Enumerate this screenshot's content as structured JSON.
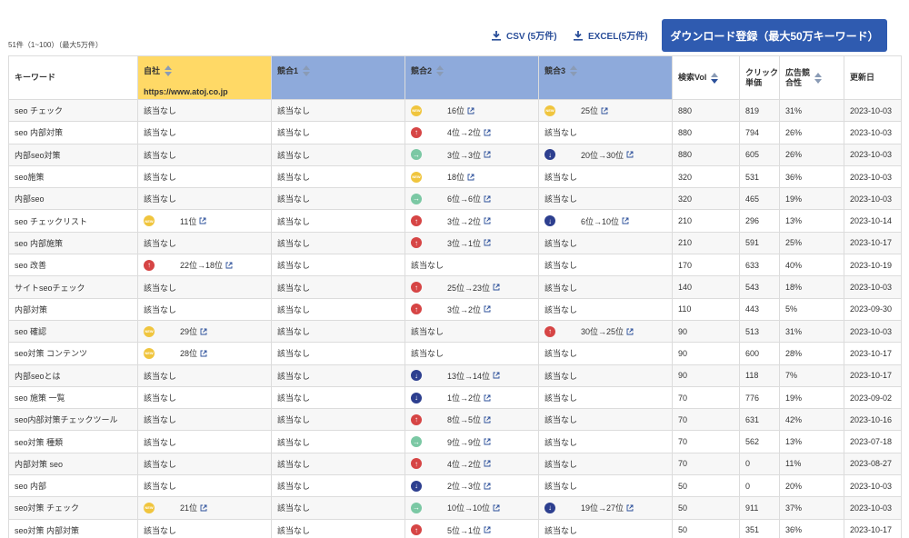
{
  "toolbar": {
    "count_text": "51件（1~100）（最大5万件）",
    "csv_label": "CSV (5万件)",
    "excel_label": "EXCEL(5万件)",
    "register_label": "ダウンロード登録（最大50万キーワード）"
  },
  "headers": {
    "keyword": "キーワード",
    "self": "自社",
    "self_url": "https://www.atoj.co.jp",
    "comp1": "競合1",
    "comp2": "競合2",
    "comp3": "競合3",
    "volume": "検索Vol",
    "cpc_line1": "クリック",
    "cpc_line2": "単価",
    "competition_line1": "広告競",
    "competition_line2": "合性",
    "updated": "更新日"
  },
  "colors": {
    "self_header": "#ffd966",
    "comp_header": "#8eaadb",
    "button": "#2f5bb0",
    "up": "#d64545",
    "down": "#2d3f8f",
    "same": "#7bc8a4",
    "new": "#f0c53e"
  },
  "none_text": "該当なし",
  "rows": [
    {
      "kw": "seo チェック",
      "self": null,
      "c1": null,
      "c2": {
        "icon": "new",
        "text": "16位"
      },
      "c3": {
        "icon": "new",
        "text": "25位"
      },
      "vol": "880",
      "cpc": "819",
      "comp": "31%",
      "date": "2023-10-03"
    },
    {
      "kw": "seo 内部対策",
      "self": null,
      "c1": null,
      "c2": {
        "icon": "up",
        "text": "4位→2位"
      },
      "c3": null,
      "vol": "880",
      "cpc": "794",
      "comp": "26%",
      "date": "2023-10-03"
    },
    {
      "kw": "内部seo対策",
      "self": null,
      "c1": null,
      "c2": {
        "icon": "same",
        "text": "3位→3位"
      },
      "c3": {
        "icon": "down",
        "text": "20位→30位"
      },
      "vol": "880",
      "cpc": "605",
      "comp": "26%",
      "date": "2023-10-03"
    },
    {
      "kw": "seo施策",
      "self": null,
      "c1": null,
      "c2": {
        "icon": "new",
        "text": "18位"
      },
      "c3": null,
      "vol": "320",
      "cpc": "531",
      "comp": "36%",
      "date": "2023-10-03"
    },
    {
      "kw": "内部seo",
      "self": null,
      "c1": null,
      "c2": {
        "icon": "same",
        "text": "6位→6位"
      },
      "c3": null,
      "vol": "320",
      "cpc": "465",
      "comp": "19%",
      "date": "2023-10-03"
    },
    {
      "kw": "seo チェックリスト",
      "self": {
        "icon": "new",
        "text": "11位"
      },
      "c1": null,
      "c2": {
        "icon": "up",
        "text": "3位→2位"
      },
      "c3": {
        "icon": "down",
        "text": "6位→10位"
      },
      "vol": "210",
      "cpc": "296",
      "comp": "13%",
      "date": "2023-10-14"
    },
    {
      "kw": "seo 内部施策",
      "self": null,
      "c1": null,
      "c2": {
        "icon": "up",
        "text": "3位→1位"
      },
      "c3": null,
      "vol": "210",
      "cpc": "591",
      "comp": "25%",
      "date": "2023-10-17"
    },
    {
      "kw": "seo 改善",
      "self": {
        "icon": "up",
        "text": "22位→18位"
      },
      "c1": null,
      "c2": null,
      "c3": null,
      "vol": "170",
      "cpc": "633",
      "comp": "40%",
      "date": "2023-10-19"
    },
    {
      "kw": "サイトseoチェック",
      "self": null,
      "c1": null,
      "c2": {
        "icon": "up",
        "text": "25位→23位"
      },
      "c3": null,
      "vol": "140",
      "cpc": "543",
      "comp": "18%",
      "date": "2023-10-03"
    },
    {
      "kw": "内部対策",
      "self": null,
      "c1": null,
      "c2": {
        "icon": "up",
        "text": "3位→2位"
      },
      "c3": null,
      "vol": "110",
      "cpc": "443",
      "comp": "5%",
      "date": "2023-09-30"
    },
    {
      "kw": "seo 確認",
      "self": {
        "icon": "new",
        "text": "29位"
      },
      "c1": null,
      "c2": null,
      "c3": {
        "icon": "up",
        "text": "30位→25位"
      },
      "vol": "90",
      "cpc": "513",
      "comp": "31%",
      "date": "2023-10-03"
    },
    {
      "kw": "seo対策 コンテンツ",
      "self": {
        "icon": "new",
        "text": "28位"
      },
      "c1": null,
      "c2": null,
      "c3": null,
      "vol": "90",
      "cpc": "600",
      "comp": "28%",
      "date": "2023-10-17"
    },
    {
      "kw": "内部seoとは",
      "self": null,
      "c1": null,
      "c2": {
        "icon": "down",
        "text": "13位→14位"
      },
      "c3": null,
      "vol": "90",
      "cpc": "118",
      "comp": "7%",
      "date": "2023-10-17"
    },
    {
      "kw": "seo 施策 一覧",
      "self": null,
      "c1": null,
      "c2": {
        "icon": "down",
        "text": "1位→2位"
      },
      "c3": null,
      "vol": "70",
      "cpc": "776",
      "comp": "19%",
      "date": "2023-09-02"
    },
    {
      "kw": "seo内部対策チェックツール",
      "self": null,
      "c1": null,
      "c2": {
        "icon": "up",
        "text": "8位→5位"
      },
      "c3": null,
      "vol": "70",
      "cpc": "631",
      "comp": "42%",
      "date": "2023-10-16"
    },
    {
      "kw": "seo対策 種類",
      "self": null,
      "c1": null,
      "c2": {
        "icon": "same",
        "text": "9位→9位"
      },
      "c3": null,
      "vol": "70",
      "cpc": "562",
      "comp": "13%",
      "date": "2023-07-18"
    },
    {
      "kw": "内部対策 seo",
      "self": null,
      "c1": null,
      "c2": {
        "icon": "up",
        "text": "4位→2位"
      },
      "c3": null,
      "vol": "70",
      "cpc": "0",
      "comp": "11%",
      "date": "2023-08-27"
    },
    {
      "kw": "seo 内部",
      "self": null,
      "c1": null,
      "c2": {
        "icon": "down",
        "text": "2位→3位"
      },
      "c3": null,
      "vol": "50",
      "cpc": "0",
      "comp": "20%",
      "date": "2023-10-03"
    },
    {
      "kw": "seo対策 チェック",
      "self": {
        "icon": "new",
        "text": "21位"
      },
      "c1": null,
      "c2": {
        "icon": "same",
        "text": "10位→10位"
      },
      "c3": {
        "icon": "down",
        "text": "19位→27位"
      },
      "vol": "50",
      "cpc": "911",
      "comp": "37%",
      "date": "2023-10-03"
    },
    {
      "kw": "seo対策 内部対策",
      "self": null,
      "c1": null,
      "c2": {
        "icon": "up",
        "text": "5位→1位"
      },
      "c3": null,
      "vol": "50",
      "cpc": "351",
      "comp": "36%",
      "date": "2023-10-17"
    }
  ]
}
